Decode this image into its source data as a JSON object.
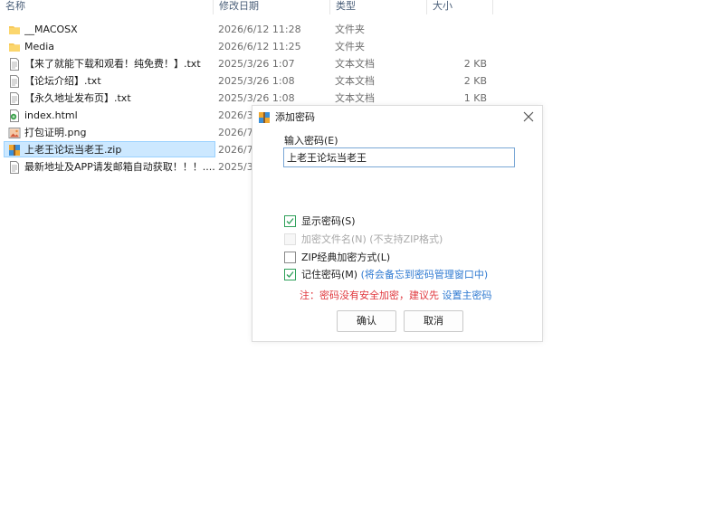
{
  "columns": {
    "name": "名称",
    "date": "修改日期",
    "type": "类型",
    "size": "大小"
  },
  "files": [
    {
      "name": "__MACOSX",
      "date": "2026/6/12 11:28",
      "type": "文件夹",
      "size": "",
      "icon": "folder-icon",
      "selected": false
    },
    {
      "name": "Media",
      "date": "2026/6/12 11:25",
      "type": "文件夹",
      "size": "",
      "icon": "folder-icon",
      "selected": false
    },
    {
      "name": "【来了就能下载和观看！纯免费！】.txt",
      "date": "2025/3/26 1:07",
      "type": "文本文档",
      "size": "2 KB",
      "icon": "text-file-icon",
      "selected": false
    },
    {
      "name": "【论坛介绍】.txt",
      "date": "2025/3/26 1:08",
      "type": "文本文档",
      "size": "2 KB",
      "icon": "text-file-icon",
      "selected": false
    },
    {
      "name": "【永久地址发布页】.txt",
      "date": "2025/3/26 1:08",
      "type": "文本文档",
      "size": "1 KB",
      "icon": "text-file-icon",
      "selected": false
    },
    {
      "name": "index.html",
      "date": "2026/3,",
      "type": "",
      "size": "",
      "icon": "html-file-icon",
      "selected": false
    },
    {
      "name": "打包证明.png",
      "date": "2026/7,",
      "type": "",
      "size": "",
      "icon": "image-file-icon",
      "selected": false
    },
    {
      "name": "上老王论坛当老王.zip",
      "date": "2026/7,",
      "type": "",
      "size": "",
      "icon": "zip-file-icon",
      "selected": true
    },
    {
      "name": "最新地址及APP请发邮箱自动获取！！！....",
      "date": "2025/3,",
      "type": "",
      "size": "",
      "icon": "text-file-icon",
      "selected": false
    }
  ],
  "dialog": {
    "title": "添加密码",
    "password_label": "输入密码(E)",
    "password_value": "上老王论坛当老王",
    "options": [
      {
        "label": "显示密码(S)",
        "hint": "",
        "checked": true,
        "disabled": false
      },
      {
        "label": "加密文件名(N)",
        "hint": " (不支持ZIP格式)",
        "checked": false,
        "disabled": true
      },
      {
        "label": "ZIP经典加密方式(L)",
        "hint": "",
        "checked": false,
        "disabled": false
      },
      {
        "label": "记住密码(M)",
        "hint": " (将会备忘到密码管理窗口中)",
        "checked": true,
        "disabled": false
      }
    ],
    "note_text": "注：密码没有安全加密，建议先 ",
    "note_link": "设置主密码",
    "ok_label": "确认",
    "cancel_label": "取消"
  },
  "colors": {
    "selection_bg": "#cce8ff",
    "check_green": "#2fa05a",
    "warning_red": "#e0383e",
    "link_blue": "#2f7ad1"
  }
}
